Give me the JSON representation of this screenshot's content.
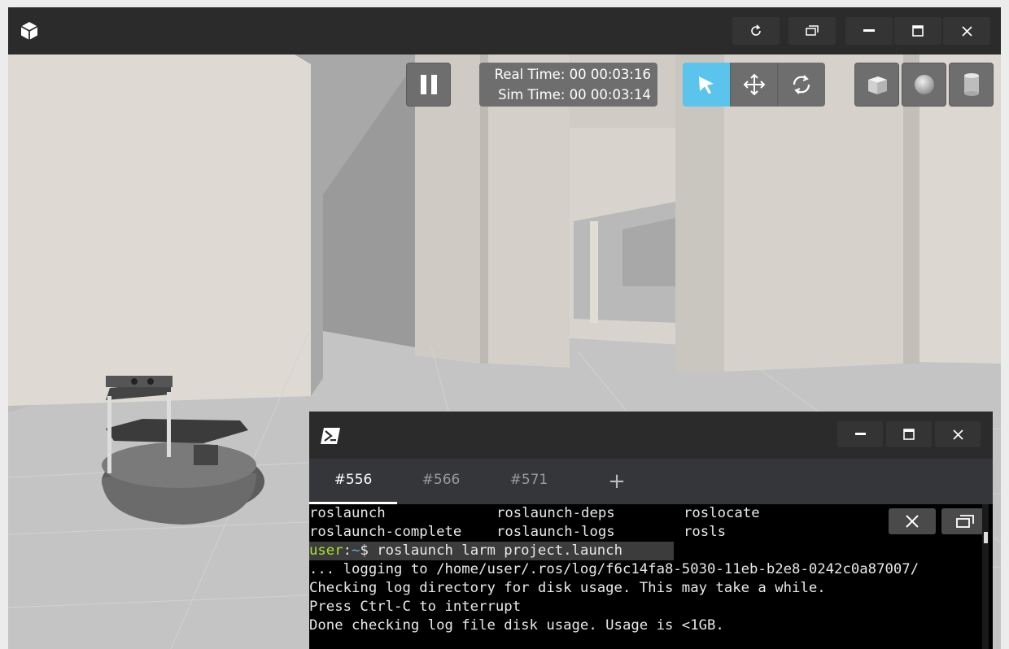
{
  "main_window": {
    "title_buttons": [
      "reload-icon",
      "restore-window-icon",
      "minimize-icon",
      "maximize-icon",
      "close-icon"
    ],
    "app_icon": "cube-icon"
  },
  "sim_overlay": {
    "pause_icon": "pause-icon",
    "real_time_label": "Real Time: 00 00:03:16",
    "sim_time_label": "Sim Time: 00 00:03:14",
    "modes": [
      {
        "name": "select",
        "icon": "cursor-icon",
        "active": true
      },
      {
        "name": "translate",
        "icon": "move-icon",
        "active": false
      },
      {
        "name": "rotate",
        "icon": "rotate-icon",
        "active": false
      }
    ],
    "shapes": [
      "box-icon",
      "sphere-icon",
      "cylinder-icon"
    ],
    "active_color": "#5bc4ec"
  },
  "terminal": {
    "app_icon": "powershell-icon",
    "tabs": [
      {
        "label": "#556",
        "active": true
      },
      {
        "label": "#566",
        "active": false
      },
      {
        "label": "#571",
        "active": false
      }
    ],
    "add_tab_label": "+",
    "completion_rows": [
      [
        "roslaunch",
        "roslaunch-deps",
        "roslocate"
      ],
      [
        "roslaunch-complete",
        "roslaunch-logs",
        "rosls"
      ]
    ],
    "prompt_user": "user",
    "prompt_sep": ":",
    "prompt_path": "~",
    "prompt_symbol": "$",
    "command": " roslaunch larm project.launch",
    "output_lines": [
      "... logging to /home/user/.ros/log/f6c14fa8-5030-11eb-b2e8-0242c0a87007/",
      "Checking log directory for disk usage. This may take a while.",
      "Press Ctrl-C to interrupt",
      "Done checking log file disk usage. Usage is <1GB."
    ],
    "user_color": "#a6e22e",
    "path_color": "#5ab0e8"
  }
}
